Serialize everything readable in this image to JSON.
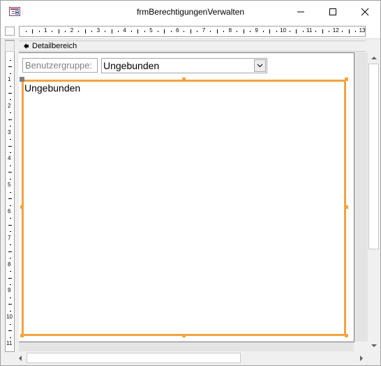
{
  "window": {
    "title": "frmBerechtigungenVerwalten",
    "buttons": {
      "minimize": "minimize-icon",
      "maximize": "maximize-icon",
      "close": "close-icon"
    }
  },
  "ruler": {
    "horizontal_numbers": [
      "1",
      "2",
      "3",
      "4",
      "5",
      "6",
      "7",
      "8",
      "9",
      "10",
      "11",
      "12",
      "13"
    ],
    "vertical_numbers": [
      "1",
      "2",
      "3",
      "4",
      "5",
      "6",
      "7",
      "8",
      "9",
      "10",
      "11"
    ]
  },
  "section": {
    "label": "Detailbereich",
    "icon": "section-arrow-icon"
  },
  "controls": {
    "label_text": "Benutzergruppe:",
    "combo_value": "Ungebunden",
    "listbox_text": "Ungebunden"
  },
  "colors": {
    "selection": "#f4a340",
    "title_icon": "#8a3f60"
  }
}
